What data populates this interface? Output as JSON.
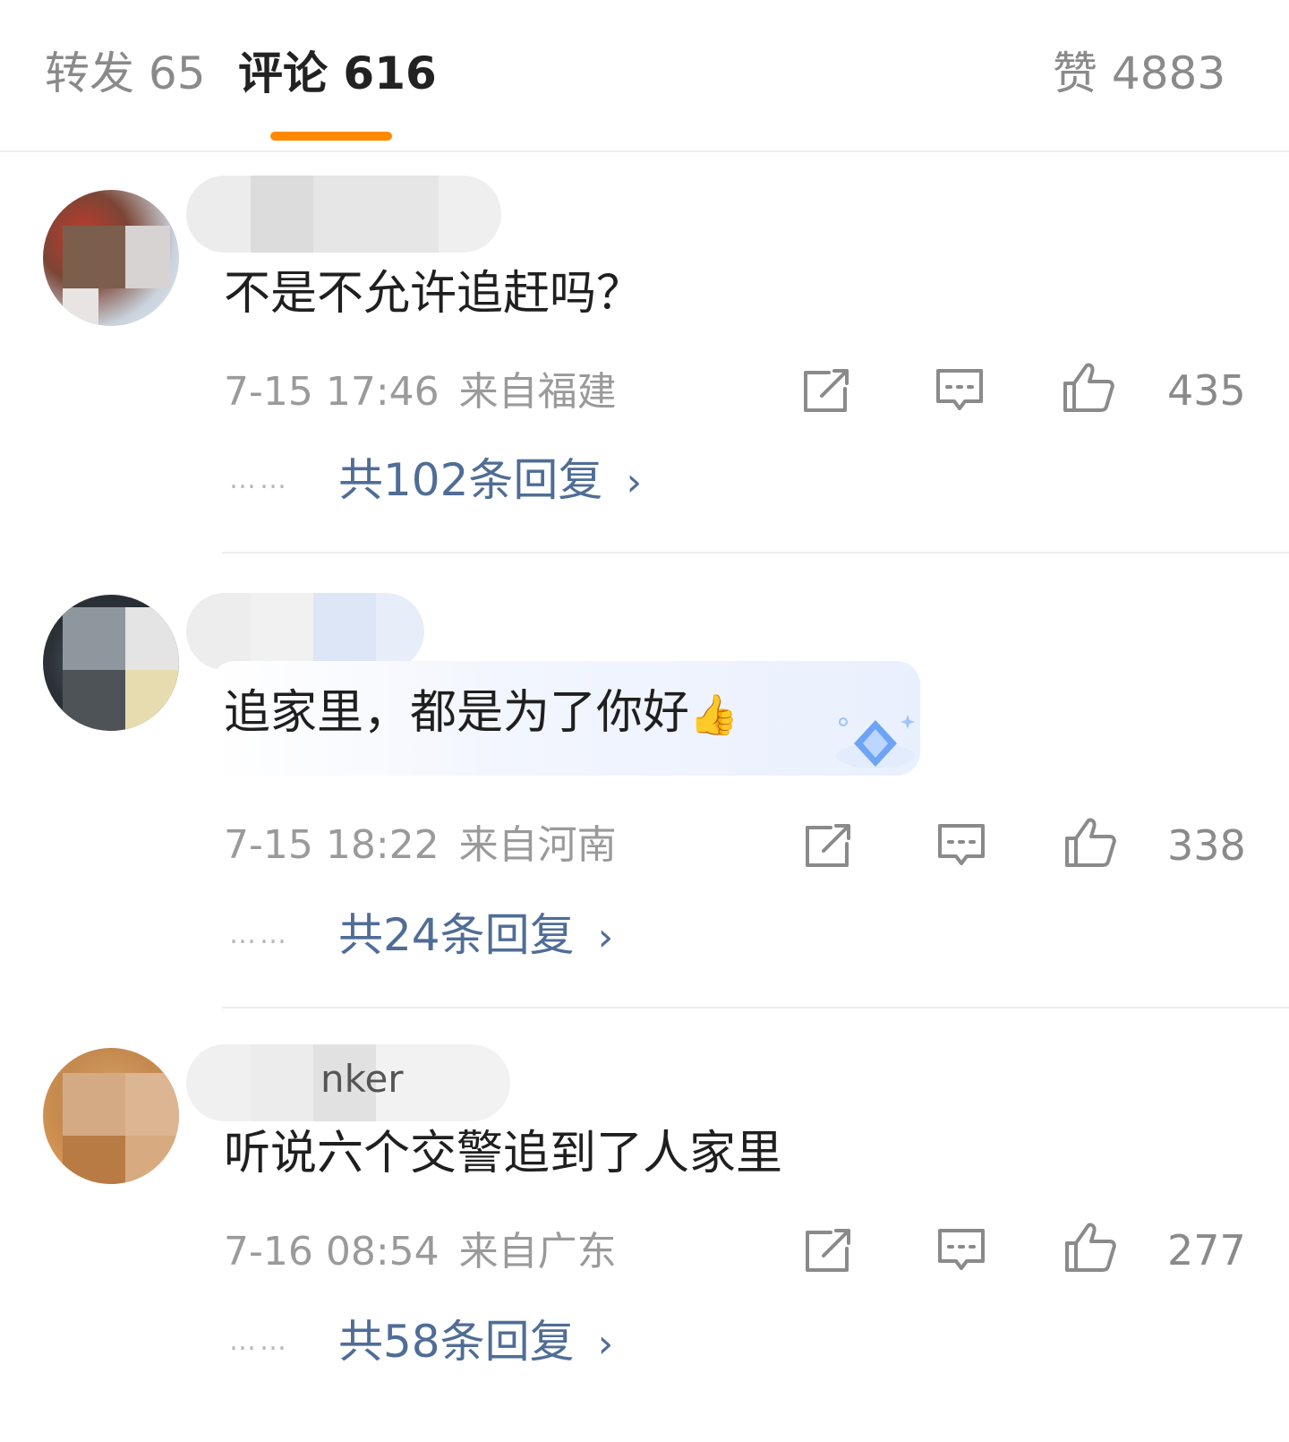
{
  "tabs": {
    "repost": "转发 65",
    "comments": "评论 616",
    "likes": "赞 4883"
  },
  "colors": {
    "accent": "#ff8a00",
    "link": "#4f6d96",
    "muted": "#9a9a9a"
  },
  "icons": {
    "share": "share-icon",
    "reply": "comment-icon",
    "like": "thumbs-up-icon",
    "chevron": "chevron-right-icon"
  },
  "comments": [
    {
      "text": "不是不允许追赶吗？",
      "time": "7-15 17:46",
      "location": "来自福建",
      "likes": "435",
      "replies": "共102条回复",
      "more_dots": "……"
    },
    {
      "text": "追家里，都是为了你好",
      "emoji": "👍",
      "time": "7-15 18:22",
      "location": "来自河南",
      "likes": "338",
      "replies": "共24条回复",
      "more_dots": "……"
    },
    {
      "username_fragment": "nker",
      "text": "听说六个交警追到了人家里",
      "time": "7-16 08:54",
      "location": "来自广东",
      "likes": "277",
      "replies": "共58条回复",
      "more_dots": "……"
    }
  ]
}
